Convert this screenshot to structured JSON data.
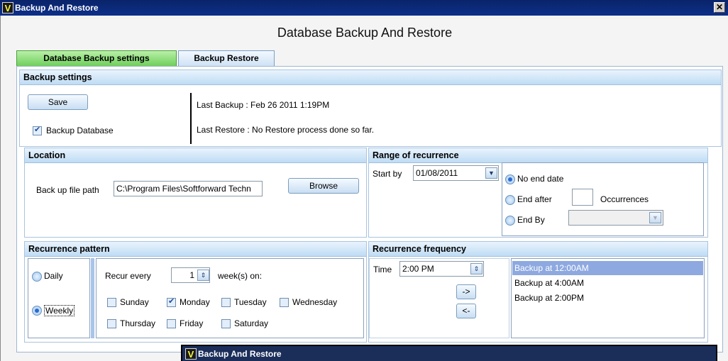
{
  "window": {
    "title": "Backup And Restore",
    "logo": "V",
    "close": "✕"
  },
  "heading": "Database Backup And Restore",
  "tabs": [
    {
      "label": "Database Backup settings",
      "active": true
    },
    {
      "label": "Backup Restore",
      "active": false
    }
  ],
  "backup_settings": {
    "title": "Backup settings",
    "save_label": "Save",
    "backup_db_label": "Backup Database",
    "backup_db_checked": true,
    "last_backup": "Last Backup : Feb 26 2011  1:19PM",
    "last_restore": "Last Restore : No Restore process done so far."
  },
  "location": {
    "title": "Location",
    "path_label": "Back up file path",
    "path_value": "C:\\Program Files\\Softforward Techn",
    "browse_label": "Browse"
  },
  "range": {
    "title": "Range of recurrence",
    "start_label": "Start by",
    "start_value": "01/08/2011",
    "no_end_label": "No end date",
    "end_after_label": "End after",
    "occurrences_value": "",
    "occurrences_label": "Occurrences",
    "end_by_label": "End By",
    "end_by_value": "",
    "selected": "no_end"
  },
  "pattern": {
    "title": "Recurrence pattern",
    "daily_label": "Daily",
    "weekly_label": "Weekly",
    "selected": "weekly",
    "recur_every_label": "Recur every",
    "recur_value": "1",
    "weeks_on_label": "week(s) on:",
    "days": [
      {
        "label": "Sunday",
        "checked": false
      },
      {
        "label": "Monday",
        "checked": true
      },
      {
        "label": "Tuesday",
        "checked": false
      },
      {
        "label": "Wednesday",
        "checked": false
      },
      {
        "label": "Thursday",
        "checked": false
      },
      {
        "label": "Friday",
        "checked": false
      },
      {
        "label": "Saturday",
        "checked": false
      }
    ]
  },
  "frequency": {
    "title": "Recurrence frequency",
    "time_label": "Time",
    "time_value": "2:00 PM",
    "add_label": "->",
    "remove_label": "<-",
    "items": [
      "Backup at 12:00AM",
      "Backup at 4:00AM",
      "Backup at 2:00PM"
    ],
    "selected_index": 0
  },
  "lower_window": {
    "title": "Backup And Restore",
    "logo": "V"
  },
  "icons": {
    "dropdown": "chevron-down-icon",
    "spinner": "spinner-icon"
  }
}
